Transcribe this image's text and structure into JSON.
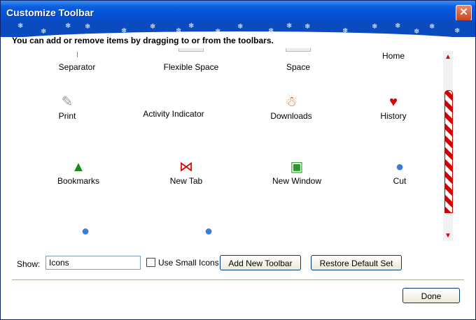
{
  "window": {
    "title": "Customize Toolbar",
    "close_label": "✕"
  },
  "instructions": "You can add or remove items by dragging to or from the toolbars.",
  "palette": {
    "items": [
      {
        "label": "Separator",
        "icon": "separator-icon"
      },
      {
        "label": "Flexible Space",
        "icon": "flexible-space-icon"
      },
      {
        "label": "Space",
        "icon": "space-icon"
      },
      {
        "label": "Home",
        "icon": "home-icon"
      },
      {
        "label": "Print",
        "icon": "print-icon"
      },
      {
        "label": "Activity Indicator",
        "icon": ""
      },
      {
        "label": "Downloads",
        "icon": "gingerbread-icon"
      },
      {
        "label": "History",
        "icon": "stocking-icon"
      },
      {
        "label": "Bookmarks",
        "icon": "tree-icon"
      },
      {
        "label": "New Tab",
        "icon": "bow-icon"
      },
      {
        "label": "New Window",
        "icon": "gift-icon"
      },
      {
        "label": "Cut",
        "icon": "ornament-icon"
      },
      {
        "label": "",
        "icon": "ornament-icon"
      },
      {
        "label": "",
        "icon": "ornament-icon"
      }
    ]
  },
  "controls": {
    "show_label": "Show:",
    "show_value": "Icons",
    "small_icons_label": "Use Small Icons",
    "add_toolbar_label": "Add New Toolbar",
    "restore_label": "Restore Default Set",
    "done_label": "Done"
  },
  "colors": {
    "title_bar": "#0551d4",
    "scroll_thumb": "#d40000"
  }
}
